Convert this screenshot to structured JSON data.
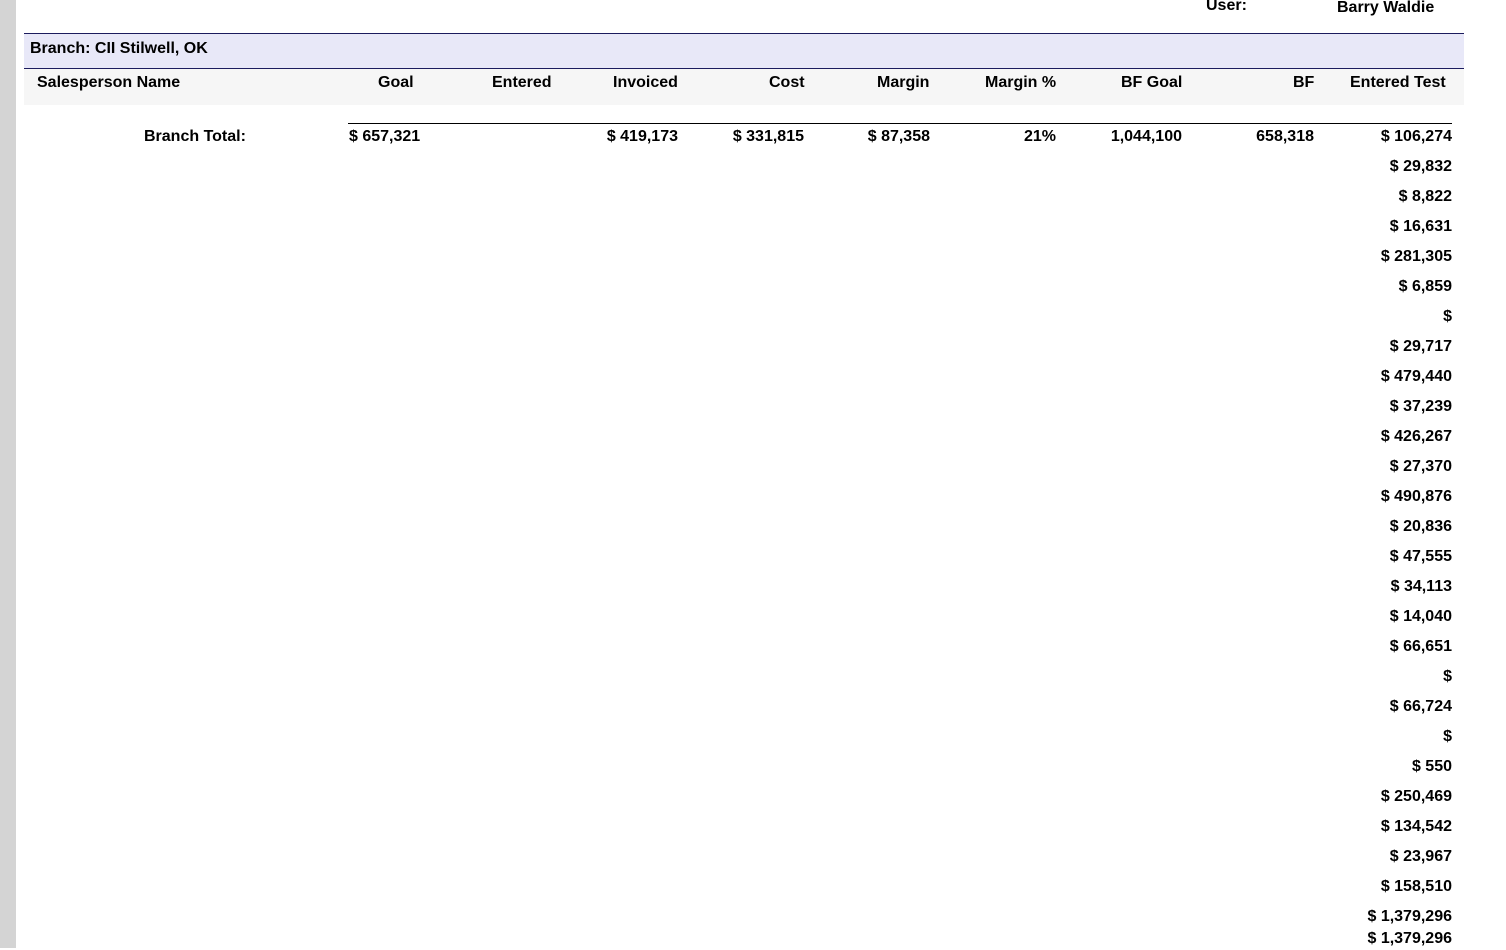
{
  "header": {
    "user_label": "User:",
    "user_name": "Barry Waldie"
  },
  "branch": {
    "label": "Branch: CII Stilwell, OK"
  },
  "columns": {
    "salesperson": "Salesperson Name",
    "goal": "Goal",
    "entered": "Entered",
    "invoiced": "Invoiced",
    "cost": "Cost",
    "margin": "Margin",
    "margin_pct": "Margin %",
    "bf_goal": "BF Goal",
    "bf": "BF",
    "entered_test": "Entered Test"
  },
  "branch_total": {
    "label": "Branch Total:",
    "goal": "$ 657,321",
    "invoiced": "$ 419,173",
    "cost": "$ 331,815",
    "margin": "$ 87,358",
    "margin_pct": "21%",
    "bf_goal": "1,044,100",
    "bf": "658,318",
    "entered_test": "$ 106,274"
  },
  "entered_test_values": [
    "$ 29,832",
    "$ 8,822",
    "$ 16,631",
    "$ 281,305",
    "$ 6,859",
    "$",
    "$ 29,717",
    "$ 479,440",
    "$ 37,239",
    "$ 426,267",
    "$ 27,370",
    "$ 490,876",
    "$ 20,836",
    "$ 47,555",
    "$ 34,113",
    "$ 14,040",
    "$ 66,651",
    "$",
    "$ 66,724",
    "$",
    "$ 550",
    "$ 250,469",
    "$ 134,542",
    "$ 23,967",
    "$ 158,510",
    "$ 1,379,296",
    "$ 1,379,296"
  ]
}
